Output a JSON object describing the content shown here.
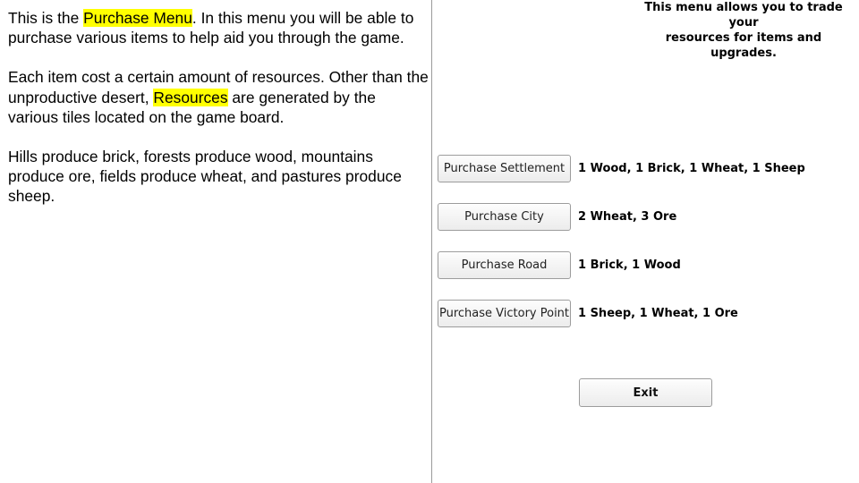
{
  "notes": {
    "p1_before": "This is the ",
    "p1_highlight": "Purchase Menu",
    "p1_after": ". In this menu you will be able to purchase various items to help aid you through the game.",
    "p2_before": "Each item cost a certain amount of resources. Other than the unproductive desert, ",
    "p2_highlight": "Resources",
    "p2_after": " are generated by the various tiles located on the game board.",
    "p3": "Hills produce brick, forests produce wood, mountains produce ore, fields produce wheat, and pastures produce sheep."
  },
  "panel": {
    "description_line1": "This menu allows you to trade your",
    "description_line2": "resources for items and upgrades.",
    "items": [
      {
        "button_label": "Purchase Settlement",
        "cost": "1 Wood, 1 Brick, 1 Wheat, 1 Sheep"
      },
      {
        "button_label": "Purchase City",
        "cost": "2 Wheat, 3 Ore"
      },
      {
        "button_label": "Purchase Road",
        "cost": "1 Brick, 1 Wood"
      },
      {
        "button_label": "Purchase Victory Point",
        "cost": "1 Sheep, 1 Wheat, 1 Ore"
      }
    ],
    "exit_label": "Exit"
  }
}
